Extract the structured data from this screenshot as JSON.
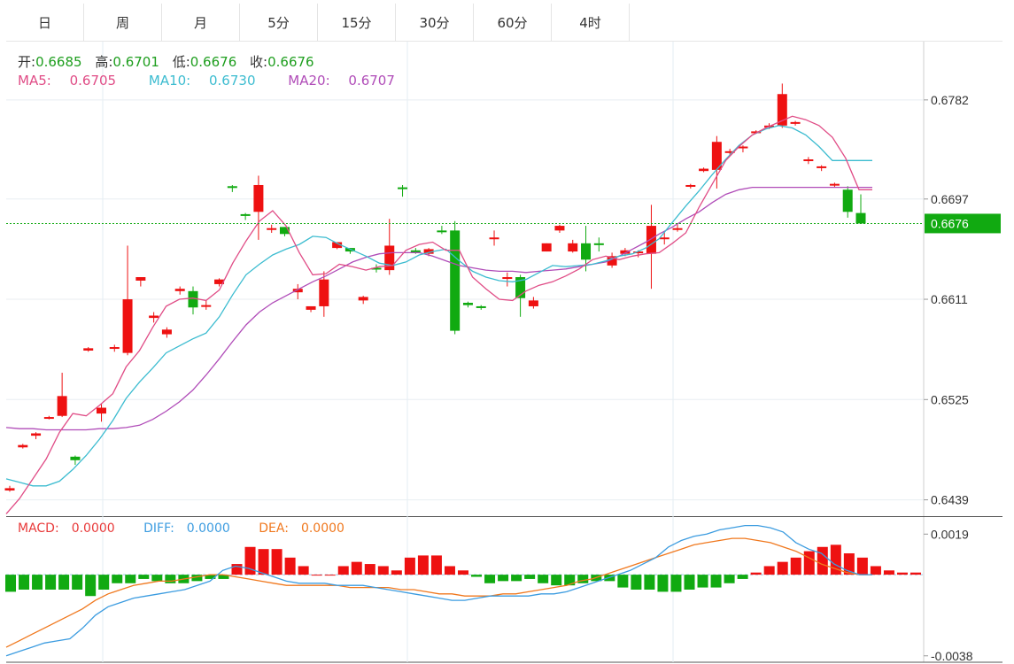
{
  "tabs": [
    {
      "label": "日",
      "active": true
    },
    {
      "label": "周",
      "active": false
    },
    {
      "label": "月",
      "active": false
    },
    {
      "label": "5分",
      "active": false
    },
    {
      "label": "15分",
      "active": false
    },
    {
      "label": "30分",
      "active": false
    },
    {
      "label": "60分",
      "active": false
    },
    {
      "label": "4时",
      "active": false
    }
  ],
  "ohlc": {
    "open_label": "开:",
    "open": "0.6685",
    "high_label": "高:",
    "high": "0.6701",
    "low_label": "低:",
    "low": "0.6676",
    "close_label": "收:",
    "close": "0.6676"
  },
  "ma": {
    "ma5_label": "MA5:",
    "ma5": "0.6705",
    "ma10_label": "MA10:",
    "ma10": "0.6730",
    "ma20_label": "MA20:",
    "ma20": "0.6707"
  },
  "macd": {
    "macd_label": "MACD:",
    "macd": "0.0000",
    "diff_label": "DIFF:",
    "diff": "0.0000",
    "dea_label": "DEA:",
    "dea": "0.0000"
  },
  "colors": {
    "up": "#ee1111",
    "down": "#11aa11",
    "ma5": "#e04c86",
    "ma10": "#3cbcd0",
    "ma20": "#b04cb8",
    "diff": "#3c9ce0",
    "dea": "#f0781e",
    "active_tab": "#f0883f"
  },
  "chart_data": {
    "type": "candlestick",
    "price_axis": {
      "ticks": [
        "0.6782",
        "0.6697",
        "0.6611",
        "0.6525",
        "0.6439"
      ],
      "ylim": [
        0.6425,
        0.6832
      ]
    },
    "current_price": "0.6676",
    "candles": [
      [
        0.6447,
        0.6449,
        0.6446,
        0.6451
      ],
      [
        0.6484,
        0.6486,
        0.6483,
        0.6487
      ],
      [
        0.6494,
        0.6496,
        0.6491,
        0.6497
      ],
      [
        0.6509,
        0.651,
        0.6508,
        0.6511
      ],
      [
        0.6511,
        0.6528,
        0.651,
        0.6548
      ],
      [
        0.6476,
        0.6473,
        0.6469,
        0.6477
      ],
      [
        0.6567,
        0.6569,
        0.6566,
        0.657
      ],
      [
        0.6513,
        0.6518,
        0.6506,
        0.6521
      ],
      [
        0.6569,
        0.657,
        0.6566,
        0.6572
      ],
      [
        0.6565,
        0.6611,
        0.6563,
        0.6657
      ],
      [
        0.6627,
        0.663,
        0.6622,
        0.663
      ],
      [
        0.6595,
        0.6597,
        0.6591,
        0.66
      ],
      [
        0.6581,
        0.6585,
        0.6578,
        0.6587
      ],
      [
        0.6618,
        0.662,
        0.6615,
        0.6622
      ],
      [
        0.6618,
        0.6604,
        0.6598,
        0.6622
      ],
      [
        0.6606,
        0.6606,
        0.6602,
        0.661
      ],
      [
        0.6624,
        0.6628,
        0.6622,
        0.6629
      ],
      [
        0.6708,
        0.6707,
        0.6703,
        0.6709
      ],
      [
        0.6684,
        0.6683,
        0.6679,
        0.6685
      ],
      [
        0.6686,
        0.6709,
        0.6662,
        0.6717
      ],
      [
        0.6671,
        0.6672,
        0.6668,
        0.6675
      ],
      [
        0.6673,
        0.6667,
        0.6665,
        0.6673
      ],
      [
        0.6617,
        0.662,
        0.6611,
        0.6624
      ],
      [
        0.6602,
        0.6605,
        0.66,
        0.6605
      ],
      [
        0.6605,
        0.6628,
        0.6596,
        0.6635
      ],
      [
        0.6655,
        0.666,
        0.6654,
        0.666
      ],
      [
        0.6655,
        0.6652,
        0.665,
        0.6655
      ],
      [
        0.661,
        0.6613,
        0.6607,
        0.6614
      ],
      [
        0.6638,
        0.6637,
        0.6634,
        0.6641
      ],
      [
        0.6636,
        0.6657,
        0.6632,
        0.668
      ],
      [
        0.6707,
        0.6706,
        0.6699,
        0.6709
      ],
      [
        0.6653,
        0.6651,
        0.665,
        0.6655
      ],
      [
        0.665,
        0.6654,
        0.6648,
        0.6655
      ],
      [
        0.667,
        0.6669,
        0.6667,
        0.6674
      ],
      [
        0.667,
        0.6584,
        0.6581,
        0.6678
      ],
      [
        0.6608,
        0.6606,
        0.6604,
        0.6609
      ],
      [
        0.6605,
        0.6604,
        0.6602,
        0.6606
      ],
      [
        0.6664,
        0.6664,
        0.6657,
        0.667
      ],
      [
        0.663,
        0.663,
        0.6622,
        0.6634
      ],
      [
        0.663,
        0.6612,
        0.6596,
        0.6632
      ],
      [
        0.6605,
        0.661,
        0.6603,
        0.6613
      ],
      [
        0.6652,
        0.6659,
        0.6652,
        0.6659
      ],
      [
        0.667,
        0.6674,
        0.6668,
        0.6675
      ],
      [
        0.6652,
        0.6659,
        0.6651,
        0.6662
      ],
      [
        0.6659,
        0.6645,
        0.6635,
        0.6674
      ],
      [
        0.6659,
        0.6658,
        0.6652,
        0.6664
      ],
      [
        0.664,
        0.6648,
        0.6638,
        0.6651
      ],
      [
        0.665,
        0.6653,
        0.6648,
        0.6655
      ],
      [
        0.6651,
        0.6652,
        0.6647,
        0.6653
      ],
      [
        0.665,
        0.6674,
        0.662,
        0.6692
      ],
      [
        0.6664,
        0.6664,
        0.6658,
        0.6669
      ],
      [
        0.6672,
        0.6672,
        0.6669,
        0.6675
      ],
      [
        0.6708,
        0.6709,
        0.6706,
        0.671
      ],
      [
        0.6721,
        0.6723,
        0.672,
        0.6724
      ],
      [
        0.6722,
        0.6746,
        0.6706,
        0.6751
      ],
      [
        0.6737,
        0.6738,
        0.6734,
        0.674
      ],
      [
        0.6741,
        0.6742,
        0.6737,
        0.6743
      ],
      [
        0.6754,
        0.6755,
        0.6753,
        0.6756
      ],
      [
        0.676,
        0.676,
        0.6757,
        0.6762
      ],
      [
        0.676,
        0.6787,
        0.6758,
        0.6796
      ],
      [
        0.6762,
        0.6763,
        0.676,
        0.6764
      ],
      [
        0.6731,
        0.6731,
        0.6727,
        0.6733
      ],
      [
        0.6725,
        0.6725,
        0.6721,
        0.6726
      ],
      [
        0.6709,
        0.671,
        0.6707,
        0.6711
      ],
      [
        0.6705,
        0.6686,
        0.6681,
        0.6708
      ],
      [
        0.6685,
        0.6676,
        0.6676,
        0.6701
      ]
    ],
    "ma5": [
      0.6427,
      0.644,
      0.6457,
      0.6474,
      0.6497,
      0.6513,
      0.6511,
      0.652,
      0.653,
      0.6553,
      0.6567,
      0.6587,
      0.6605,
      0.6611,
      0.6612,
      0.661,
      0.6619,
      0.6642,
      0.6661,
      0.6678,
      0.6687,
      0.6674,
      0.6651,
      0.6632,
      0.6633,
      0.6641,
      0.6639,
      0.6636,
      0.6639,
      0.664,
      0.6653,
      0.6658,
      0.666,
      0.6653,
      0.6653,
      0.663,
      0.662,
      0.6611,
      0.661,
      0.6618,
      0.6623,
      0.6626,
      0.6631,
      0.6637,
      0.6645,
      0.6648,
      0.6645,
      0.6648,
      0.665,
      0.6651,
      0.6659,
      0.6668,
      0.669,
      0.671,
      0.673,
      0.6742,
      0.6752,
      0.6758,
      0.6763,
      0.6768,
      0.6765,
      0.676,
      0.675,
      0.6732,
      0.6705,
      0.6705
    ],
    "ma10": [
      0.6457,
      0.6454,
      0.6451,
      0.6451,
      0.6455,
      0.6465,
      0.6477,
      0.6491,
      0.6507,
      0.6526,
      0.654,
      0.6552,
      0.6565,
      0.6571,
      0.6577,
      0.6582,
      0.6596,
      0.6615,
      0.6632,
      0.6641,
      0.6649,
      0.6654,
      0.6658,
      0.6665,
      0.6664,
      0.6658,
      0.6653,
      0.6648,
      0.6642,
      0.664,
      0.6643,
      0.6649,
      0.6652,
      0.6654,
      0.6644,
      0.6635,
      0.663,
      0.6627,
      0.6626,
      0.6628,
      0.6634,
      0.664,
      0.6639,
      0.664,
      0.6641,
      0.6644,
      0.6648,
      0.665,
      0.6655,
      0.6663,
      0.6677,
      0.6691,
      0.6704,
      0.6718,
      0.6731,
      0.6743,
      0.6752,
      0.6757,
      0.676,
      0.6758,
      0.6752,
      0.6742,
      0.673,
      0.673,
      0.673,
      0.673
    ],
    "ma20": [
      0.6501,
      0.65,
      0.65,
      0.6499,
      0.6499,
      0.6499,
      0.6499,
      0.65,
      0.65,
      0.6501,
      0.6503,
      0.6508,
      0.6515,
      0.6523,
      0.6533,
      0.6546,
      0.656,
      0.6575,
      0.6589,
      0.66,
      0.6608,
      0.6614,
      0.662,
      0.6626,
      0.6631,
      0.6637,
      0.6643,
      0.6647,
      0.665,
      0.6651,
      0.6651,
      0.6651,
      0.6648,
      0.6644,
      0.664,
      0.6638,
      0.6636,
      0.6635,
      0.6635,
      0.6634,
      0.6635,
      0.6636,
      0.6637,
      0.6639,
      0.6641,
      0.6643,
      0.6648,
      0.6654,
      0.666,
      0.6667,
      0.6673,
      0.668,
      0.6686,
      0.6694,
      0.6701,
      0.6705,
      0.6707,
      0.6707,
      0.6707,
      0.6707,
      0.6707,
      0.6707,
      0.6707,
      0.6707,
      0.6707,
      0.6707
    ],
    "macd_axis": {
      "ticks": [
        "0.0019",
        "-0.0038"
      ],
      "ylim": [
        -0.0041,
        0.0027
      ]
    },
    "macd_hist": [
      -0.0008,
      -0.0007,
      -0.0007,
      -0.0007,
      -0.0007,
      -0.0007,
      -0.001,
      -0.0007,
      -0.0004,
      -0.0004,
      -0.0002,
      -0.0003,
      -0.0004,
      -0.0004,
      -0.0003,
      -0.0002,
      -0.0002,
      0.0005,
      0.0013,
      0.0012,
      0.0012,
      0.0008,
      0.0004,
      0.0,
      0.0,
      0.0004,
      0.0006,
      0.0005,
      0.0004,
      0.0002,
      0.0008,
      0.0009,
      0.0009,
      0.0004,
      0.0002,
      -0.0001,
      -0.0004,
      -0.0003,
      -0.0003,
      -0.0002,
      -0.0004,
      -0.0005,
      -0.0005,
      -0.0004,
      -0.0003,
      -0.0003,
      -0.0006,
      -0.0007,
      -0.0007,
      -0.0008,
      -0.0008,
      -0.0007,
      -0.0006,
      -0.0006,
      -0.0004,
      -0.0002,
      0.0001,
      0.0004,
      0.0006,
      0.0008,
      0.0011,
      0.0013,
      0.0014,
      0.001,
      0.0008,
      0.0004,
      0.0002,
      0.0001,
      0.0001
    ],
    "diff": [
      -0.0038,
      -0.0036,
      -0.0034,
      -0.0032,
      -0.0031,
      -0.003,
      -0.0025,
      -0.0019,
      -0.0015,
      -0.0013,
      -0.0011,
      -0.001,
      -0.0009,
      -0.0008,
      -0.0007,
      -0.0005,
      -0.0003,
      0.0002,
      0.0004,
      0.0003,
      0.0001,
      -0.0001,
      -0.0003,
      -0.0004,
      -0.0004,
      -0.0004,
      -0.0005,
      -0.0005,
      -0.0005,
      -0.0006,
      -0.0007,
      -0.0008,
      -0.0009,
      -0.001,
      -0.0011,
      -0.0012,
      -0.0012,
      -0.0011,
      -0.001,
      -0.001,
      -0.001,
      -0.001,
      -0.0009,
      -0.0009,
      -0.0008,
      -0.0006,
      -0.0004,
      -0.0002,
      0.0,
      0.0002,
      0.0005,
      0.0008,
      0.0013,
      0.0016,
      0.0018,
      0.0019,
      0.0021,
      0.0022,
      0.0023,
      0.0023,
      0.0022,
      0.002,
      0.0015,
      0.0012,
      0.001,
      0.0005,
      0.0002,
      0.0,
      0.0
    ],
    "dea": [
      -0.0034,
      -0.0031,
      -0.0028,
      -0.0025,
      -0.0022,
      -0.0019,
      -0.0016,
      -0.0012,
      -0.0009,
      -0.0007,
      -0.0005,
      -0.0004,
      -0.0003,
      -0.0003,
      -0.0002,
      -0.0001,
      0.0,
      0.0,
      -0.0001,
      -0.0002,
      -0.0003,
      -0.0004,
      -0.0005,
      -0.0005,
      -0.0005,
      -0.0005,
      -0.0005,
      -0.0006,
      -0.0006,
      -0.0006,
      -0.0006,
      -0.0007,
      -0.0007,
      -0.0008,
      -0.0009,
      -0.0009,
      -0.001,
      -0.001,
      -0.001,
      -0.0009,
      -0.0009,
      -0.0008,
      -0.0007,
      -0.0006,
      -0.0005,
      -0.0003,
      -0.0002,
      0.0,
      0.0002,
      0.0004,
      0.0006,
      0.0008,
      0.001,
      0.0012,
      0.0014,
      0.0015,
      0.0016,
      0.0017,
      0.0017,
      0.0016,
      0.0015,
      0.0013,
      0.0011,
      0.0008,
      0.0005,
      0.0003,
      0.0001,
      0.0,
      0.0
    ]
  }
}
